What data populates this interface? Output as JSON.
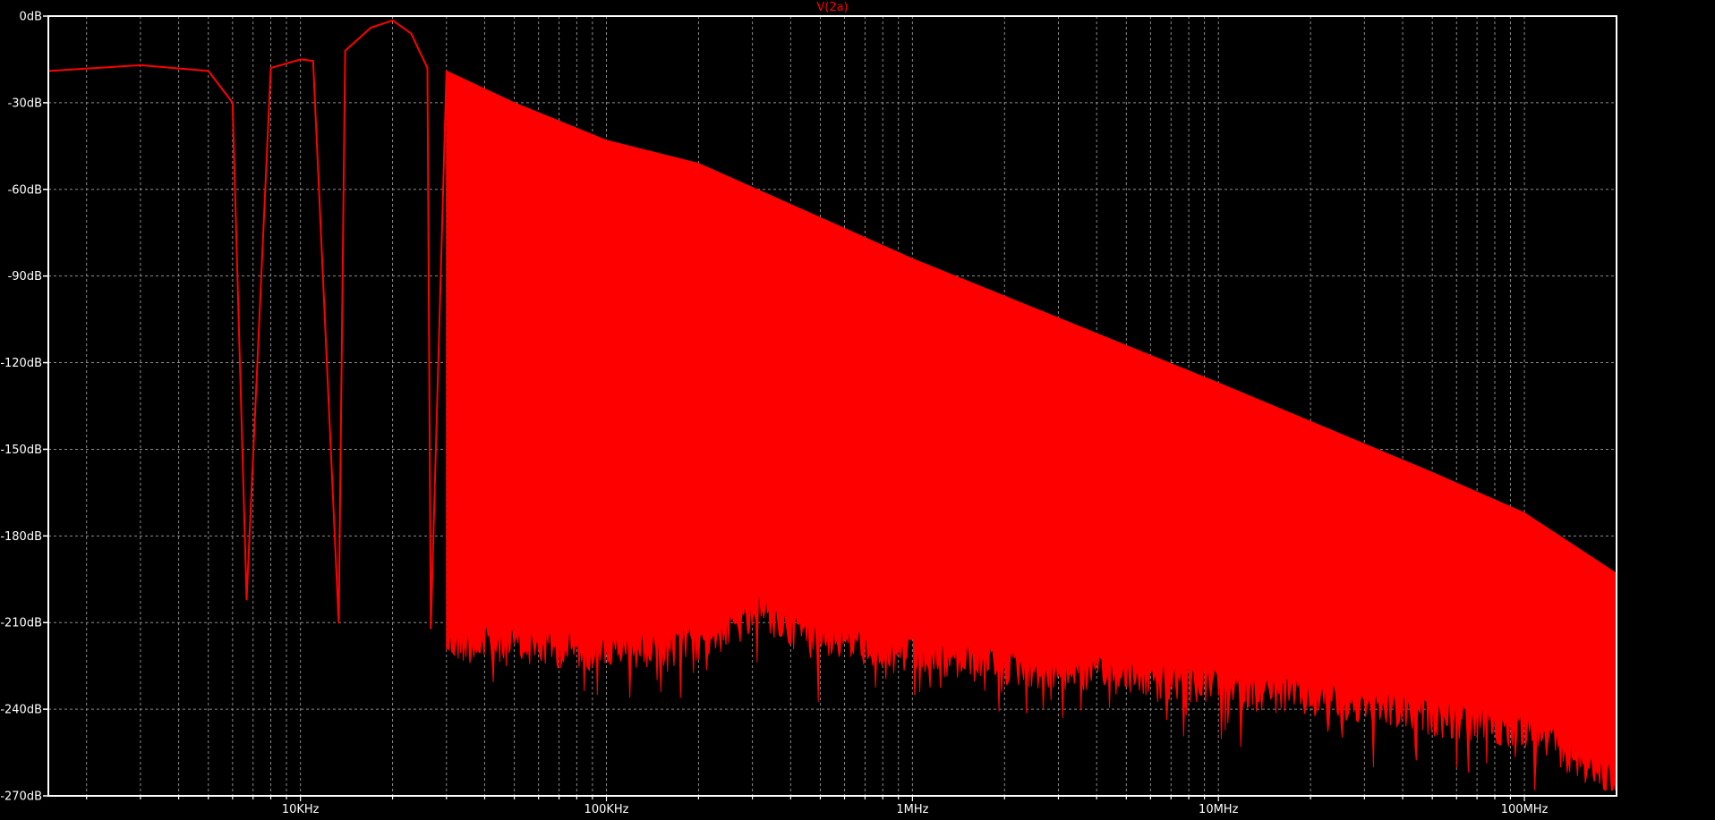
{
  "chart_data": {
    "type": "line",
    "title": "V(2a)",
    "xscale": "log",
    "xlim": [
      1500,
      200000000
    ],
    "ylim": [
      -270,
      0
    ],
    "yunit": "dB",
    "grid": true,
    "y_ticks": [
      {
        "value": 0,
        "label": "0dB"
      },
      {
        "value": -30,
        "label": "-30dB"
      },
      {
        "value": -60,
        "label": "-60dB"
      },
      {
        "value": -90,
        "label": "-90dB"
      },
      {
        "value": -120,
        "label": "-120dB"
      },
      {
        "value": -150,
        "label": "-150dB"
      },
      {
        "value": -180,
        "label": "-180dB"
      },
      {
        "value": -210,
        "label": "-210dB"
      },
      {
        "value": -240,
        "label": "-240dB"
      },
      {
        "value": -270,
        "label": "-270dB"
      }
    ],
    "x_ticks": [
      {
        "value": 10000,
        "label": "10KHz"
      },
      {
        "value": 100000,
        "label": "100KHz"
      },
      {
        "value": 1000000,
        "label": "1MHz"
      },
      {
        "value": 10000000,
        "label": "10MHz"
      },
      {
        "value": 100000000,
        "label": "100MHz"
      }
    ],
    "series": [
      {
        "name": "V(2a)",
        "color": "#ff0000",
        "fundamental_hz": 6667,
        "low_band": {
          "x": [
            1500,
            3000,
            5000,
            6000,
            6667,
            8000,
            10000,
            11000,
            13333,
            14000,
            17000,
            20000,
            23000,
            26000,
            26667,
            30000,
            33333
          ],
          "y": [
            -19,
            -17,
            -19,
            -30,
            -202,
            -18,
            -15,
            -15.5,
            -210,
            -12,
            -4,
            -1.5,
            -6,
            -18,
            -212,
            -19,
            -207
          ]
        },
        "upper_envelope": {
          "x": [
            30000,
            50000,
            100000,
            200000,
            1000000,
            10000000,
            50000000,
            100000000,
            200000000
          ],
          "y": [
            -19,
            -30,
            -43,
            -51,
            -84,
            -127,
            -158,
            -172,
            -193
          ]
        },
        "lower_envelope": {
          "x": [
            30000,
            100000,
            200000,
            330000,
            400000,
            1000000,
            10000000,
            100000000,
            200000000
          ],
          "y": [
            -210,
            -213,
            -210,
            -200,
            -205,
            -215,
            -225,
            -240,
            -258
          ]
        }
      }
    ]
  }
}
